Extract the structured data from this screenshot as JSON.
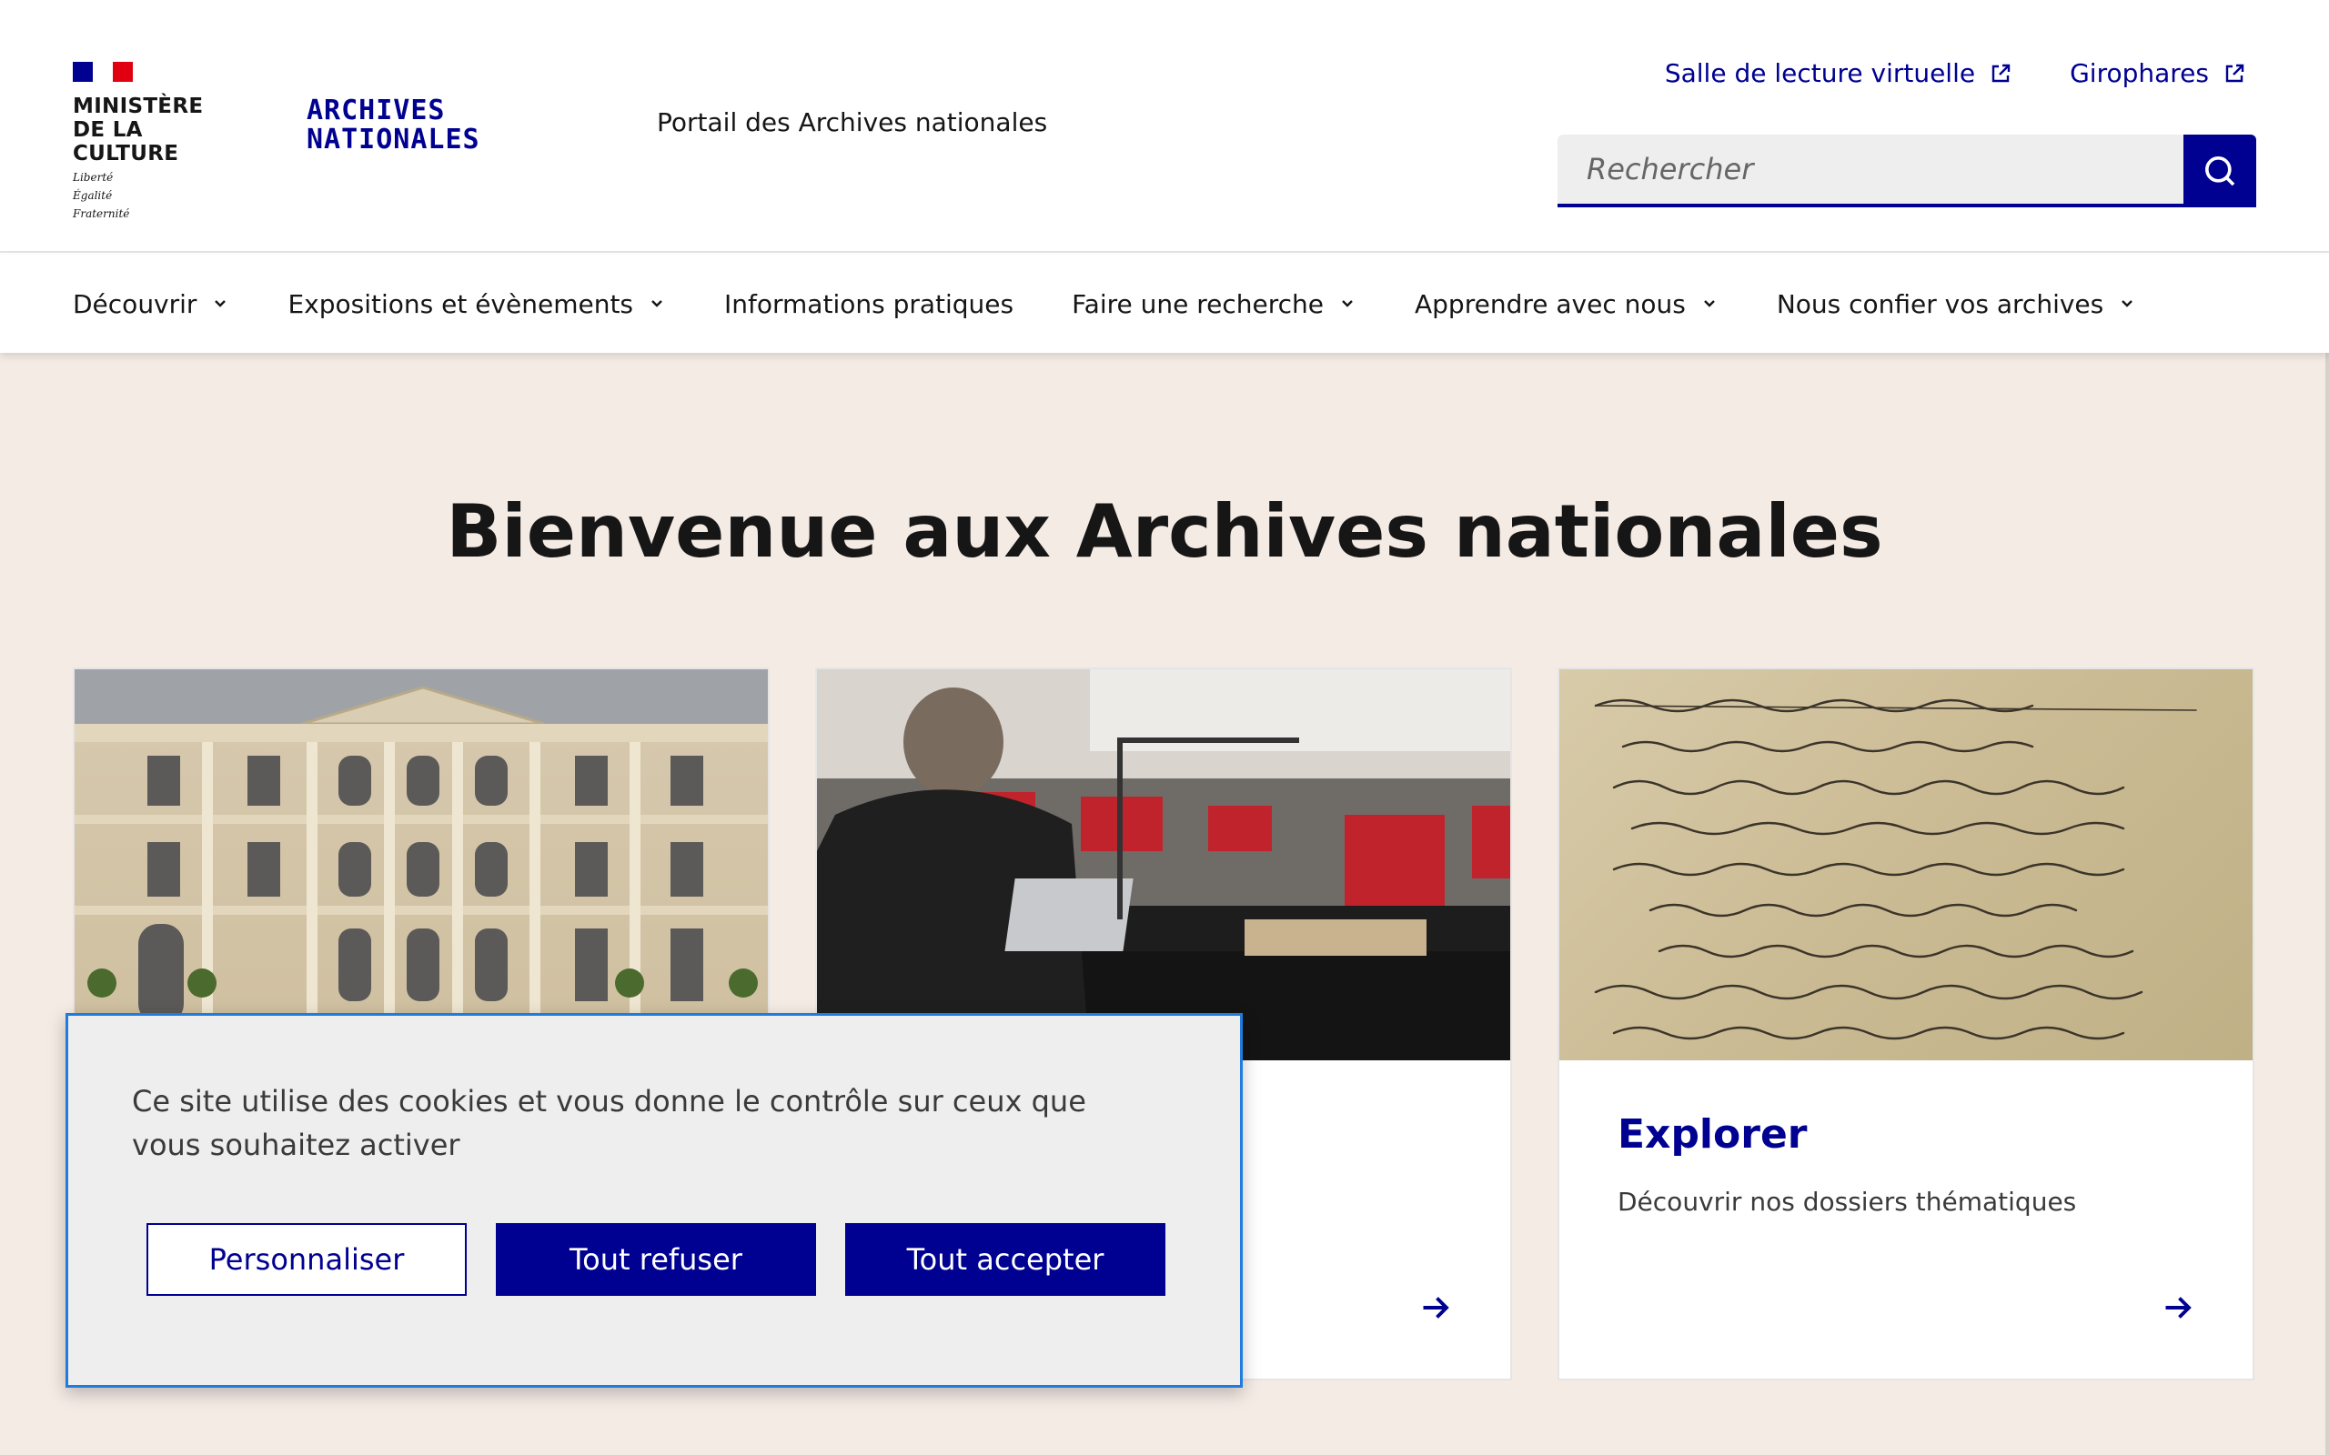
{
  "header": {
    "ministry_line1": "MINISTÈRE",
    "ministry_line2": "DE LA CULTURE",
    "motto_1": "Liberté",
    "motto_2": "Égalité",
    "motto_3": "Fraternité",
    "logo_line1": "ARCHIVES",
    "logo_line2": "NATIONALES",
    "portal": "Portail des Archives nationales",
    "quick_links": [
      {
        "label": "Salle de lecture virtuelle",
        "icon": "external-link-icon"
      },
      {
        "label": "Girophares",
        "icon": "external-link-icon"
      }
    ],
    "search": {
      "placeholder": "Rechercher",
      "icon": "search-icon"
    }
  },
  "nav": {
    "items": [
      {
        "label": "Découvrir",
        "has_menu": true
      },
      {
        "label": "Expositions et évènements",
        "has_menu": true
      },
      {
        "label": "Informations pratiques",
        "has_menu": false
      },
      {
        "label": "Faire une recherche",
        "has_menu": true
      },
      {
        "label": "Apprendre avec nous",
        "has_menu": true
      },
      {
        "label": "Nous confier vos archives",
        "has_menu": true
      }
    ]
  },
  "main": {
    "title": "Bienvenue aux Archives nationales",
    "cards": [
      {
        "title": "",
        "desc": ""
      },
      {
        "title": "",
        "desc": ""
      },
      {
        "title": "Explorer",
        "desc": "Découvrir nos dossiers thématiques"
      }
    ]
  },
  "cookie": {
    "text": "Ce site utilise des cookies et vous donne le contrôle sur ceux que vous souhaitez activer",
    "buttons": {
      "customize": "Personnaliser",
      "refuse": "Tout refuser",
      "accept": "Tout accepter"
    }
  },
  "colors": {
    "accent": "#000091",
    "background": "#f5ebe5",
    "focus_outline": "#1e7be0"
  }
}
